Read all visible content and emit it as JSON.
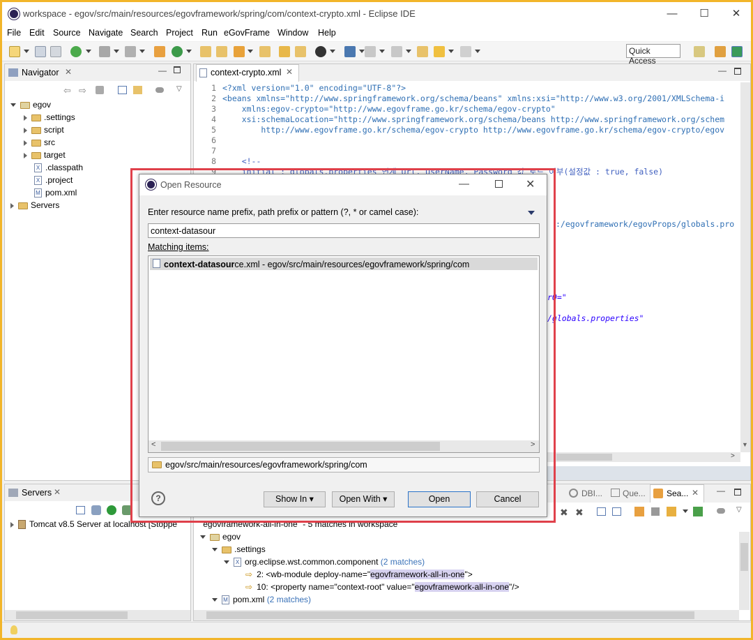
{
  "window": {
    "title": "workspace - egov/src/main/resources/egovframework/spring/com/context-crypto.xml - Eclipse IDE",
    "minimize": "—",
    "maximize": "☐",
    "close": "✕"
  },
  "menu": [
    "File",
    "Edit",
    "Source",
    "Navigate",
    "Search",
    "Project",
    "Run",
    "eGovFrame",
    "Window",
    "Help"
  ],
  "quick_access": "Quick Access",
  "navigator": {
    "title": "Navigator",
    "items": [
      {
        "label": "egov"
      },
      {
        "label": ".settings"
      },
      {
        "label": "script"
      },
      {
        "label": "src"
      },
      {
        "label": "target"
      },
      {
        "label": ".classpath"
      },
      {
        "label": ".project"
      },
      {
        "label": "pom.xml"
      },
      {
        "label": "Servers"
      }
    ]
  },
  "editor": {
    "tab": "context-crypto.xml",
    "lines": [
      {
        "n": "1",
        "t": "<?xml version=\"1.0\" encoding=\"UTF-8\"?>"
      },
      {
        "n": "2",
        "t": "<beans xmlns=\"http://www.springframework.org/schema/beans\" xmlns:xsi=\"http://www.w3.org/2001/XMLSchema-i"
      },
      {
        "n": "3",
        "t": "    xmlns:egov-crypto=\"http://www.egovframe.go.kr/schema/egov-crypto\""
      },
      {
        "n": "4",
        "t": "    xsi:schemaLocation=\"http://www.springframework.org/schema/beans http://www.springframework.org/schem"
      },
      {
        "n": "5",
        "t": "        http://www.egovframe.go.kr/schema/egov-crypto http://www.egovframe.go.kr/schema/egov-crypto/egov"
      },
      {
        "n": "6",
        "t": ""
      },
      {
        "n": "7",
        "t": ""
      },
      {
        "n": "8",
        "t": "    <!--"
      },
      {
        "n": "9",
        "t": "    initial : globals.properties 연계 Url, UserName, Password 값 로드 여부(설정값 : true, false)"
      }
    ],
    "frag1": ":/egovframework/egovProps/globals.pro",
    "frag2": "rQ=\"",
    "frag3": "/globals.properties\""
  },
  "servers": {
    "title": "Servers",
    "item": "Tomcat v8.5 Server at localhost  [Stoppe"
  },
  "bottom_tabs": [
    "DBI...",
    "Que...",
    "Sea..."
  ],
  "search": {
    "header": "\"egovframework-all-in-one\" - 5 matches in workspace",
    "tree": [
      {
        "label": "egov"
      },
      {
        "label": ".settings"
      },
      {
        "label": "org.eclipse.wst.common.component",
        "count": "(2 matches)"
      },
      {
        "pre": "2: <wb-module deploy-name=\"",
        "hl": "egovframework-all-in-one",
        "post": "\">"
      },
      {
        "pre": "10: <property name=\"context-root\" value=\"",
        "hl": "egovframework-all-in-one",
        "post": "\"/>"
      },
      {
        "label": "pom.xml",
        "count": "(2 matches)"
      }
    ]
  },
  "dialog": {
    "title": "Open Resource",
    "prompt": "Enter resource name prefix, path prefix or pattern (?, * or camel case):",
    "input_value": "context-datasour",
    "matching_label": "Matching items:",
    "result_bold": "context-datasour",
    "result_rest": "ce.xml - egov/src/main/resources/egovframework/spring/com",
    "path": "egov/src/main/resources/egovframework/spring/com",
    "show_in": "Show In",
    "open_with": "Open With",
    "open": "Open",
    "cancel": "Cancel",
    "help": "?"
  }
}
